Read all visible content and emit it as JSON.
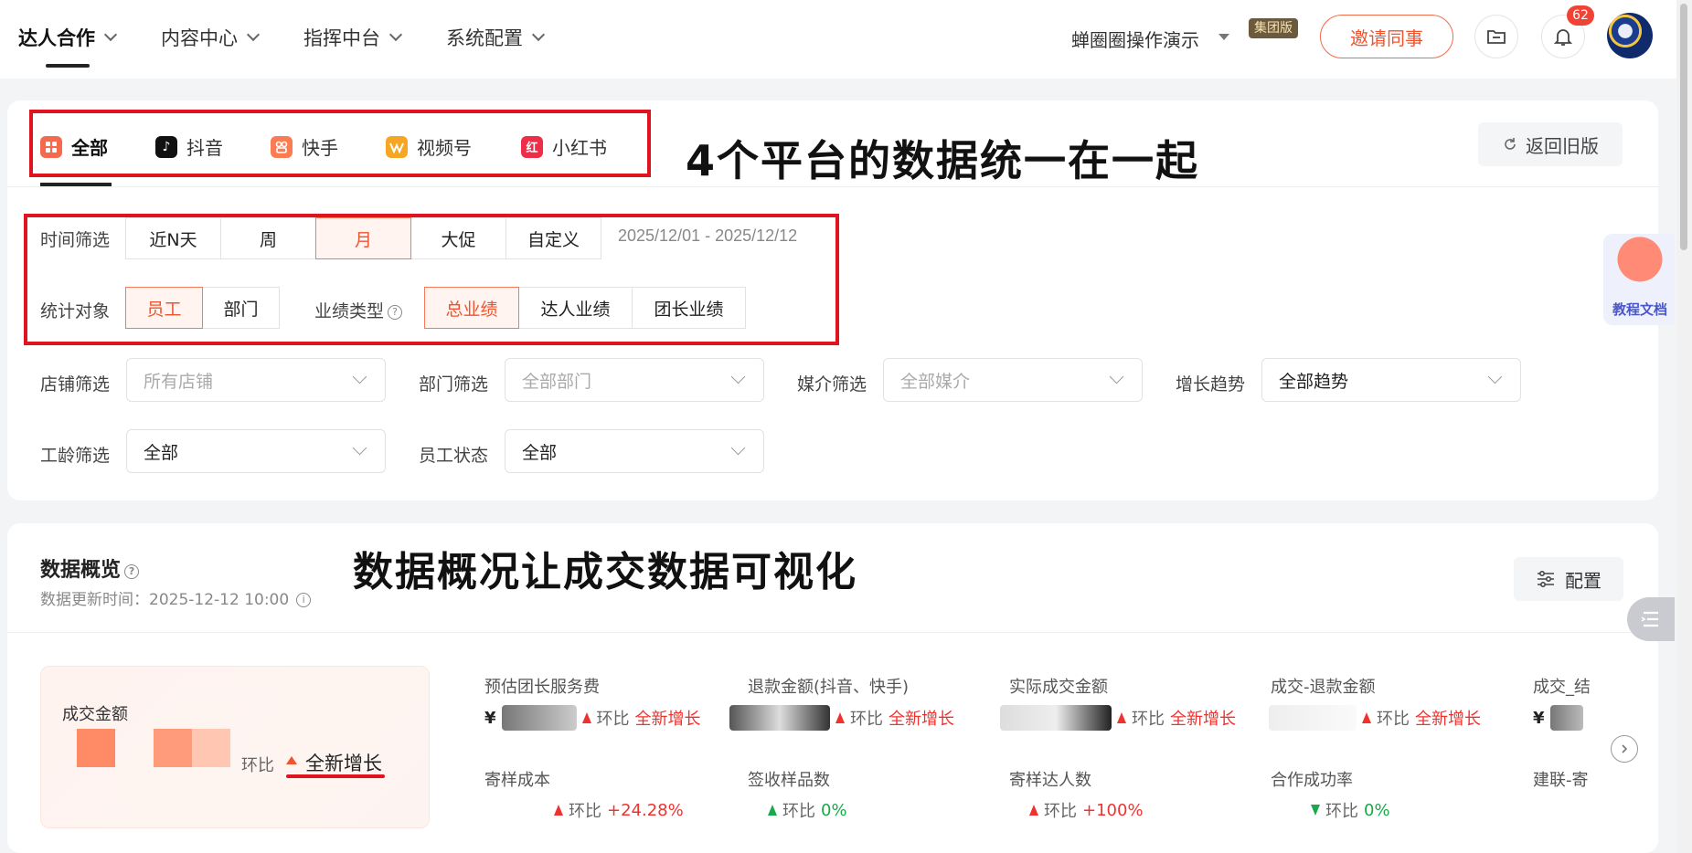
{
  "topnav": {
    "items": [
      {
        "label": "达人合作"
      },
      {
        "label": "内容中心"
      },
      {
        "label": "指挥中台"
      },
      {
        "label": "系统配置"
      }
    ],
    "org_name": "蝉圈圈操作演示",
    "group_badge": "集团版",
    "invite_label": "邀请同事",
    "notification_count": "62"
  },
  "platform_tabs": [
    {
      "label": "全部",
      "icon": "all-grid-icon",
      "color": "#f46a4c"
    },
    {
      "label": "抖音",
      "icon": "douyin-icon",
      "color": "#111111"
    },
    {
      "label": "快手",
      "icon": "kuaishou-icon",
      "color": "#fb7b52"
    },
    {
      "label": "视频号",
      "icon": "channels-icon",
      "color": "#f5a623"
    },
    {
      "label": "小红书",
      "icon": "xiaohongshu-icon",
      "color": "#ee2e48"
    }
  ],
  "annotations": {
    "platforms_note": "4个平台的数据统一在一起",
    "overview_note": "数据概况让成交数据可视化"
  },
  "back_old_label": "返回旧版",
  "time_filter": {
    "label": "时间筛选",
    "options": [
      "近N天",
      "周",
      "月",
      "大促",
      "自定义"
    ],
    "selected": "月",
    "date_range": "2025/12/01 - 2025/12/12"
  },
  "stat_target": {
    "label": "统计对象",
    "options": [
      "员工",
      "部门"
    ],
    "selected": "员工"
  },
  "perf_type": {
    "label": "业绩类型",
    "options": [
      "总业绩",
      "达人业绩",
      "团长业绩"
    ],
    "selected": "总业绩"
  },
  "selects": {
    "shop": {
      "label": "店铺筛选",
      "placeholder": "所有店铺"
    },
    "dept": {
      "label": "部门筛选",
      "placeholder": "全部部门"
    },
    "media": {
      "label": "媒介筛选",
      "placeholder": "全部媒介"
    },
    "trend": {
      "label": "增长趋势",
      "value": "全部趋势"
    },
    "tenure": {
      "label": "工龄筛选",
      "value": "全部"
    },
    "status": {
      "label": "员工状态",
      "value": "全部"
    }
  },
  "overview": {
    "title": "数据概览",
    "updated": "数据更新时间：2025-12-12 10:00",
    "config_label": "配置",
    "main_metric": {
      "label": "成交金额",
      "huanbi": "环比",
      "growth": "全新增长"
    },
    "metrics_row1": [
      {
        "label": "预估团长服务费",
        "prefix": "¥",
        "huanbi": "环比",
        "change": "全新增长"
      },
      {
        "label": "退款金额(抖音、快手)",
        "prefix": "",
        "huanbi": "环比",
        "change": "全新增长"
      },
      {
        "label": "实际成交金额",
        "prefix": "",
        "huanbi": "环比",
        "change": "全新增长"
      },
      {
        "label": "成交-退款金额",
        "prefix": "",
        "huanbi": "环比",
        "change": "全新增长"
      },
      {
        "label": "成交_结",
        "prefix": "¥",
        "huanbi": "",
        "change": ""
      }
    ],
    "metrics_row2": [
      {
        "label": "寄样成本",
        "huanbi": "环比",
        "change": "+24.28%",
        "dir": "up"
      },
      {
        "label": "签收样品数",
        "huanbi": "环比",
        "change": "0%",
        "dir": "flat"
      },
      {
        "label": "寄样达人数",
        "huanbi": "环比",
        "change": "+100%",
        "dir": "up"
      },
      {
        "label": "合作成功率",
        "huanbi": "环比",
        "change": "0%",
        "dir": "down"
      },
      {
        "label": "建联-寄",
        "huanbi": "",
        "change": "",
        "dir": ""
      }
    ]
  },
  "tutorial_label": "教程文档"
}
